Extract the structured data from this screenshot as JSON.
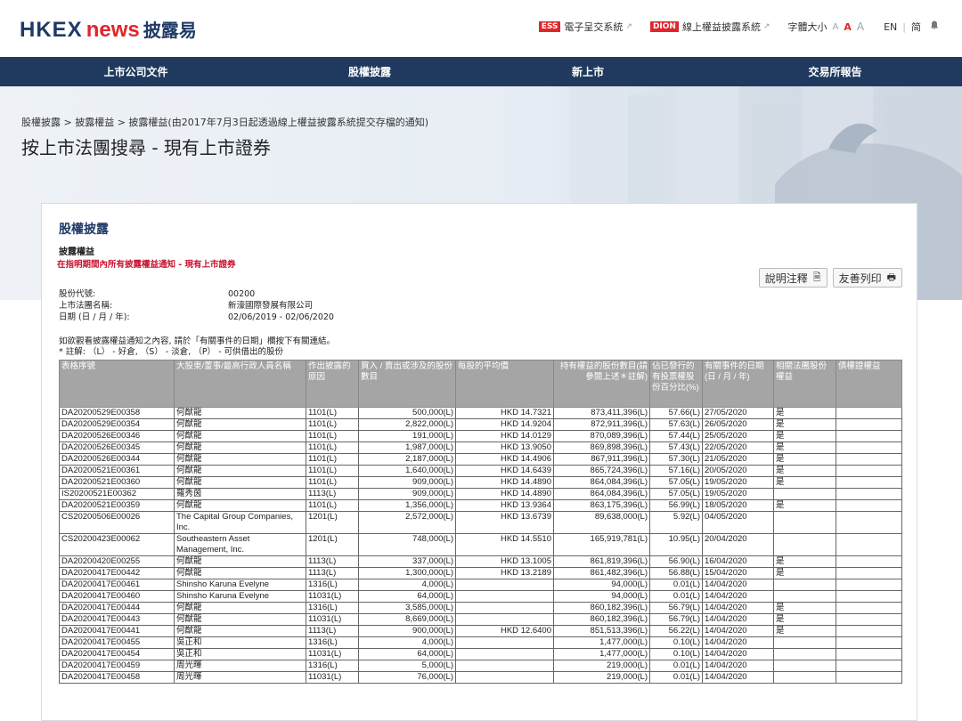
{
  "header": {
    "logo_hkex": "HKEX",
    "logo_news": "news",
    "logo_cn": "披露易",
    "links": [
      {
        "badge": "ESS",
        "label": "電子呈交系統"
      },
      {
        "badge": "DION",
        "label": "線上權益披露系統"
      }
    ],
    "font_size_label": "字體大小",
    "font_sizes": [
      "A",
      "A",
      "A"
    ],
    "lang_en": "EN",
    "lang_sc": "简"
  },
  "nav": {
    "items": [
      "上市公司文件",
      "股權披露",
      "新上市",
      "交易所報告"
    ]
  },
  "hero": {
    "breadcrumb": "股權披露 > 披露權益 > 披露權益(由2017年7月3日起透過線上權益披露系統提交存檔的通知)",
    "title": "按上市法團搜尋 - 現有上市證券"
  },
  "card": {
    "title": "股權披露",
    "subtitle": "披露權益",
    "subtitle_red": "在指明期間內所有披露權益通知 - 現有上市證券",
    "btn_notes": "說明注釋",
    "btn_print": "友善列印",
    "info": {
      "code_label": "股份代號:",
      "code_value": "00200",
      "name_label": "上市法團名稱:",
      "name_value": "新濠國際發展有限公司",
      "date_label": "日期 (日 / 月 / 年):",
      "date_value": "02/06/2019 - 02/06/2020"
    },
    "note1": "如欲觀看披露權益通知之內容, 請於「有關事件的日期」欄按下有關連結。",
    "note2": "* 註解: （L） - 好倉, （S） - 淡倉, （P） - 可供借出的股份"
  },
  "table": {
    "headers": [
      "表格序號",
      "大股東/董事/最高行政人員名稱",
      "作出披露的原因",
      "買入 / 賣出或涉及的股份數目",
      "每股的平均價",
      "持有權益的股份數目(請參閱上述＊註解)",
      "佔已發行的有投票權股份百分比(%)",
      "有關事件的日期(日 / 月 / 年)",
      "相關法團股份權益",
      "債權證權益"
    ],
    "rows": [
      [
        "DA20200529E00358",
        "何猷龍",
        "1101(L)",
        "500,000(L)",
        "HKD 14.7321",
        "873,411,396(L)",
        "57.66(L)",
        "27/05/2020",
        "是",
        ""
      ],
      [
        "DA20200529E00354",
        "何猷龍",
        "1101(L)",
        "2,822,000(L)",
        "HKD 14.9204",
        "872,911,396(L)",
        "57.63(L)",
        "26/05/2020",
        "是",
        ""
      ],
      [
        "DA20200526E00346",
        "何猷龍",
        "1101(L)",
        "191,000(L)",
        "HKD 14.0129",
        "870,089,396(L)",
        "57.44(L)",
        "25/05/2020",
        "是",
        ""
      ],
      [
        "DA20200526E00345",
        "何猷龍",
        "1101(L)",
        "1,987,000(L)",
        "HKD 13.9050",
        "869,898,396(L)",
        "57.43(L)",
        "22/05/2020",
        "是",
        ""
      ],
      [
        "DA20200526E00344",
        "何猷龍",
        "1101(L)",
        "2,187,000(L)",
        "HKD 14.4906",
        "867,911,396(L)",
        "57.30(L)",
        "21/05/2020",
        "是",
        ""
      ],
      [
        "DA20200521E00361",
        "何猷龍",
        "1101(L)",
        "1,640,000(L)",
        "HKD 14.6439",
        "865,724,396(L)",
        "57.16(L)",
        "20/05/2020",
        "是",
        ""
      ],
      [
        "DA20200521E00360",
        "何猷龍",
        "1101(L)",
        "909,000(L)",
        "HKD 14.4890",
        "864,084,396(L)",
        "57.05(L)",
        "19/05/2020",
        "是",
        ""
      ],
      [
        "IS20200521E00362",
        "羅秀茵",
        "1113(L)",
        "909,000(L)",
        "HKD 14.4890",
        "864,084,396(L)",
        "57.05(L)",
        "19/05/2020",
        "",
        ""
      ],
      [
        "DA20200521E00359",
        "何猷龍",
        "1101(L)",
        "1,356,000(L)",
        "HKD 13.9364",
        "863,175,396(L)",
        "56.99(L)",
        "18/05/2020",
        "是",
        ""
      ],
      [
        "CS20200506E00026",
        "The Capital Group Companies, Inc.",
        "1201(L)",
        "2,572,000(L)",
        "HKD 13.6739",
        "89,638,000(L)",
        "5.92(L)",
        "04/05/2020",
        "",
        ""
      ],
      [
        "CS20200423E00062",
        "Southeastern Asset Management, Inc.",
        "1201(L)",
        "748,000(L)",
        "HKD 14.5510",
        "165,919,781(L)",
        "10.95(L)",
        "20/04/2020",
        "",
        ""
      ],
      [
        "DA20200420E00255",
        "何猷龍",
        "1113(L)",
        "337,000(L)",
        "HKD 13.1005",
        "861,819,396(L)",
        "56.90(L)",
        "16/04/2020",
        "是",
        ""
      ],
      [
        "DA20200417E00442",
        "何猷龍",
        "1113(L)",
        "1,300,000(L)",
        "HKD 13.2189",
        "861,482,396(L)",
        "56.88(L)",
        "15/04/2020",
        "是",
        ""
      ],
      [
        "DA20200417E00461",
        "Shinsho Karuna Evelyne",
        "1316(L)",
        "4,000(L)",
        "",
        "94,000(L)",
        "0.01(L)",
        "14/04/2020",
        "",
        ""
      ],
      [
        "DA20200417E00460",
        "Shinsho Karuna Evelyne",
        "11031(L)",
        "64,000(L)",
        "",
        "94,000(L)",
        "0.01(L)",
        "14/04/2020",
        "",
        ""
      ],
      [
        "DA20200417E00444",
        "何猷龍",
        "1316(L)",
        "3,585,000(L)",
        "",
        "860,182,396(L)",
        "56.79(L)",
        "14/04/2020",
        "是",
        ""
      ],
      [
        "DA20200417E00443",
        "何猷龍",
        "11031(L)",
        "8,669,000(L)",
        "",
        "860,182,396(L)",
        "56.79(L)",
        "14/04/2020",
        "是",
        ""
      ],
      [
        "DA20200417E00441",
        "何猷龍",
        "1113(L)",
        "900,000(L)",
        "HKD 12.6400",
        "851,513,396(L)",
        "56.22(L)",
        "14/04/2020",
        "是",
        ""
      ],
      [
        "DA20200417E00455",
        "吳正和",
        "1316(L)",
        "4,000(L)",
        "",
        "1,477,000(L)",
        "0.10(L)",
        "14/04/2020",
        "",
        ""
      ],
      [
        "DA20200417E00454",
        "吳正和",
        "11031(L)",
        "64,000(L)",
        "",
        "1,477,000(L)",
        "0.10(L)",
        "14/04/2020",
        "",
        ""
      ],
      [
        "DA20200417E00459",
        "周光暉",
        "1316(L)",
        "5,000(L)",
        "",
        "219,000(L)",
        "0.01(L)",
        "14/04/2020",
        "",
        ""
      ],
      [
        "DA20200417E00458",
        "周光暉",
        "11031(L)",
        "76,000(L)",
        "",
        "219,000(L)",
        "0.01(L)",
        "14/04/2020",
        "",
        ""
      ]
    ]
  }
}
